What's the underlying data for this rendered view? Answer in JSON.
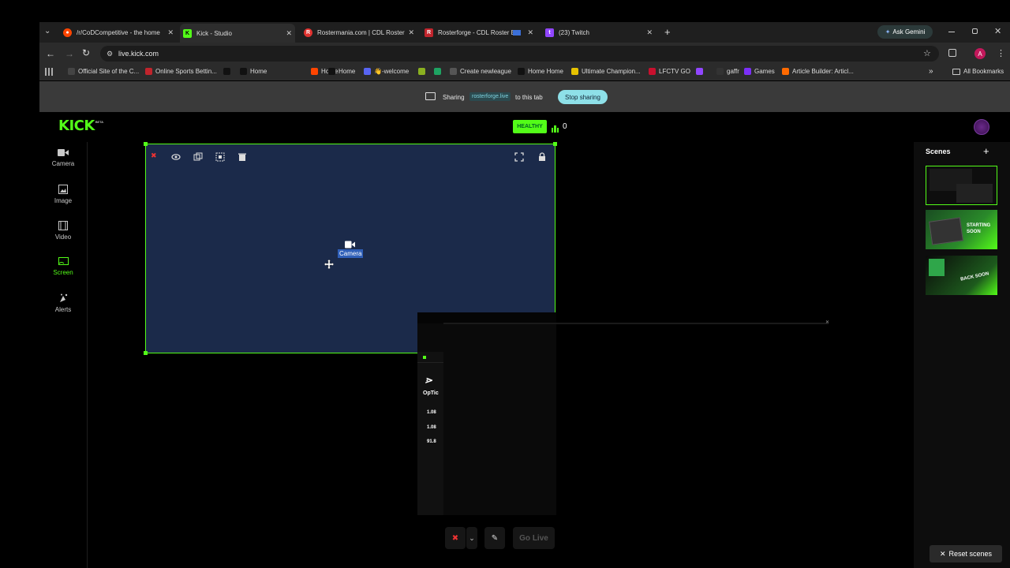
{
  "browser": {
    "tabs": [
      {
        "label": "/r/CoDCompetitive - the home",
        "color": "#ff4500"
      },
      {
        "label": "Kick - Studio",
        "color": "#53fc18"
      },
      {
        "label": "Rostermania.com | CDL Roster",
        "color": "#e0322f"
      },
      {
        "label": "Rosterforge - CDL Roster B",
        "color": "#c0242c"
      },
      {
        "label": "(23) Twitch",
        "color": "#9146ff"
      }
    ],
    "new_tab": "+",
    "ask_gemini": "Ask Gemini",
    "url": "live.kick.com",
    "profile_initial": "A",
    "bookmarks": [
      {
        "label": "Official Site of the C...",
        "icon": "cod-icon",
        "color": "#444"
      },
      {
        "label": "Online Sports Bettin...",
        "icon": "betting-icon",
        "color": "#c0242c"
      },
      {
        "label": "",
        "icon": "x-icon",
        "color": "#111"
      },
      {
        "label": "Home",
        "icon": "x-icon",
        "color": "#111"
      },
      {
        "label": "Home",
        "icon": "reddit-icon",
        "color": "#ff4500"
      },
      {
        "label": "Home",
        "icon": "x-icon",
        "color": "#111"
      },
      {
        "label": "👋-welcome",
        "icon": "discord-icon",
        "color": "#5865f2"
      },
      {
        "label": "",
        "icon": "plus-circle-icon",
        "color": "#8ab020"
      },
      {
        "label": "",
        "icon": "sheets-icon",
        "color": "#1ea362"
      },
      {
        "label": "Create newleague",
        "icon": "globe-icon",
        "color": "#555"
      },
      {
        "label": "Home Home",
        "icon": "x-icon",
        "color": "#111"
      },
      {
        "label": "Ultimate Champion...",
        "icon": "shield-icon",
        "color": "#e6c200"
      },
      {
        "label": "LFCTV GO",
        "icon": "lfc-icon",
        "color": "#c8102e"
      },
      {
        "label": "",
        "icon": "twitch-icon",
        "color": "#9146ff"
      },
      {
        "label": "gaffr",
        "icon": "gaffr-icon",
        "color": "#333"
      },
      {
        "label": "Games",
        "icon": "games-icon",
        "color": "#7b2ff7"
      },
      {
        "label": "Article Builder: Articl...",
        "icon": "article-icon",
        "color": "#ff6a00"
      }
    ],
    "bookmarks_overflow": "»",
    "all_bookmarks": "All Bookmarks"
  },
  "share": {
    "prefix": "Sharing",
    "site": "rosterforge.live",
    "suffix": "to this tab",
    "stop_label": "Stop sharing"
  },
  "kick": {
    "logo": "KICK",
    "beta": "BETA",
    "health": "HEALTHY",
    "viewer_count": "0",
    "brand_color": "#53fc18"
  },
  "sidebar": {
    "items": [
      {
        "label": "Camera",
        "icon": "camera-icon"
      },
      {
        "label": "Image",
        "icon": "image-icon"
      },
      {
        "label": "Video",
        "icon": "film-icon"
      },
      {
        "label": "Screen",
        "icon": "screen-cast-icon",
        "active": true
      },
      {
        "label": "Alerts",
        "icon": "alerts-icon"
      }
    ]
  },
  "canvas": {
    "camera_label": "Camera"
  },
  "screenshare_preview": {
    "team": "OpTic",
    "stats": [
      "1.08",
      "1.08",
      "91.8"
    ]
  },
  "scenes": {
    "title": "Scenes",
    "add": "+",
    "items": [
      {
        "label": ""
      },
      {
        "label": "STARTING SOON"
      },
      {
        "label": "BACK SOON"
      }
    ],
    "reset_label": "Reset scenes"
  },
  "bottom": {
    "go_live": "Go Live"
  }
}
